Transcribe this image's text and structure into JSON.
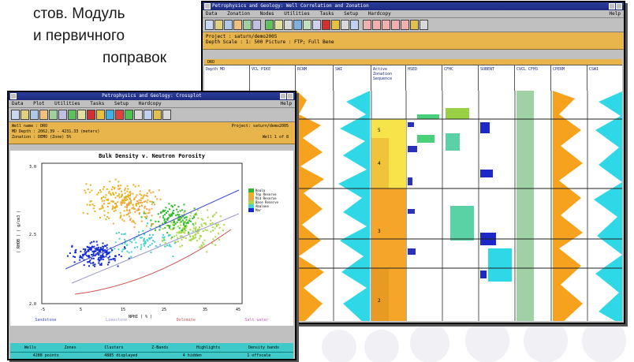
{
  "intro_text": {
    "line1": "стов. Модуль",
    "line2": "и первичного",
    "line3": "поправок"
  },
  "correlation_window": {
    "title": "Petrophysics and Geology: Well Correlation and Zonation",
    "menu": [
      "Data",
      "Zonation",
      "Nodes",
      "Utilities",
      "Tasks",
      "Setup",
      "Hardcopy"
    ],
    "help": "Help",
    "project_line": "Project : saturn/demo2005",
    "depth_line": "Depth Scale : 1: 500   Picture : FTP; Full Bene",
    "well_label": "DRO",
    "depth_header": "Depth MD",
    "depth_value": "1960",
    "tracks": [
      "VCL PIKE",
      "RCNM",
      "SWI",
      "Active Zonation Sequence",
      "HSED",
      "CFHC",
      "SUBENT",
      "CVCL CFHS",
      "CPERM",
      "CSWI"
    ],
    "zone_labels": [
      "5",
      "4",
      "3",
      "2"
    ]
  },
  "crossplot_window": {
    "title": "Petrophysics and Geology: Crossplot",
    "menu": [
      "Data",
      "Plot",
      "Utilities",
      "Tasks",
      "Setup",
      "Hardcopy"
    ],
    "help": "Help",
    "well_line": "Well name : DRO",
    "md_line": "MD Depth : 2062.39 - 4231.33 (meters)",
    "zonation_line": "Zonation : DEMO (Zone) 5%",
    "project_line": "Project: saturn/demo2005",
    "well_count": "Well  1  of  8",
    "plot_title": "Bulk Density v. Neutron Porosity",
    "y_axis": "( RHOB ) ( g/cm3 )",
    "x_axis": "NPHI ( % )",
    "y_ticks": [
      "3.0",
      "2.5",
      "2.0"
    ],
    "x_ticks": [
      "-5",
      "5",
      "15",
      "25",
      "35",
      "45"
    ],
    "legend": [
      {
        "label": "Koala",
        "color": "#2db92d"
      },
      {
        "label": "Top Reserve",
        "color": "#e8b21a"
      },
      {
        "label": "Mid Reserve",
        "color": "#f0a640"
      },
      {
        "label": "Base Reserve",
        "color": "#a8d84a"
      },
      {
        "label": "Abalone",
        "color": "#4ad0d0"
      },
      {
        "label": "Mar",
        "color": "#1028d8"
      }
    ],
    "line_key": [
      {
        "label": "Sandstone",
        "color": "#3a4ad0"
      },
      {
        "label": "Limestone",
        "color": "#9a9ad0"
      },
      {
        "label": "Dolomite",
        "color": "#d05050"
      },
      {
        "label": "Salt water",
        "color": "#c060c0"
      }
    ],
    "buttons": [
      "Wells",
      "Zones",
      "Clusters",
      "Z-Bands",
      "Highlights",
      "Density bands"
    ],
    "status": [
      "4288 points",
      "4885 displayed",
      "4 hidden",
      "1 offscale"
    ]
  }
}
